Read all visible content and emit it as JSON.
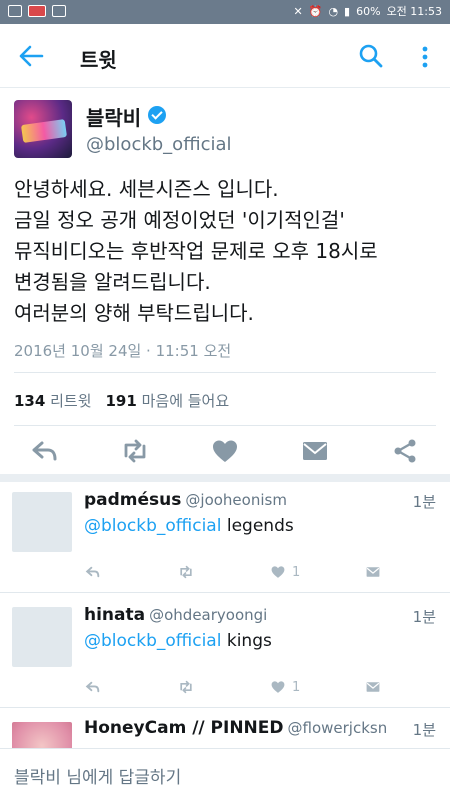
{
  "status_bar": {
    "battery": "60%",
    "time": "오전 11:53"
  },
  "app_bar": {
    "title": "트윗"
  },
  "tweet": {
    "author": "블락비",
    "handle": "@blockb_official",
    "lines": [
      "안녕하세요. 세븐시즌스 입니다.",
      "금일 정오 공개 예정이었던 '이기적인걸'",
      "뮤직비디오는 후반작업 문제로 오후 18시로",
      "변경됨을 알려드립니다.",
      "여러분의 양해 부탁드립니다."
    ],
    "timestamp": "2016년 10월 24일 · 11:51 오전",
    "retweets_count": "134",
    "retweets_label": "리트윗",
    "likes_count": "191",
    "likes_label": "마음에 들어요"
  },
  "replies": [
    {
      "name": "padmésus",
      "handle": "@jooheonism",
      "time": "1분",
      "mention": "@blockb_official",
      "text": " legends",
      "likes": "1"
    },
    {
      "name": "hinata",
      "handle": "@ohdearyoongi",
      "time": "1분",
      "mention": "@blockb_official",
      "text": " kings",
      "likes": "1"
    },
    {
      "name": "HoneyCam // PINNED",
      "handle": "@flowerjcksn",
      "time": "1분"
    }
  ],
  "reply_placeholder": "블락비 님에게 답글하기",
  "colors": {
    "accent": "#1da1f2",
    "status_bar": "#6b7b8c"
  }
}
